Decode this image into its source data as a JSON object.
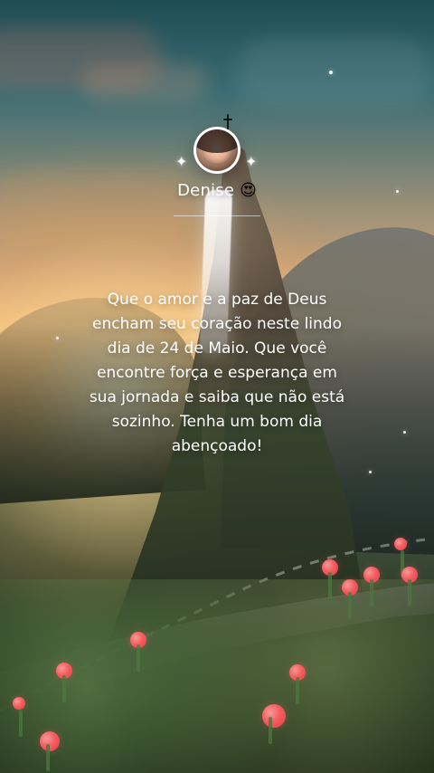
{
  "card": {
    "user": {
      "name": "Denise",
      "emoji": "😍"
    },
    "message": "Que o amor e a paz de Deus encham seu coração neste lindo dia de 24 de Maio. Que você encontre força e esperança em sua jornada e saiba que não está sozinho. Tenha um bom dia abençoado!",
    "icons": {
      "cross": "cross-icon",
      "sparkle": "sparkle-icon",
      "avatar": "avatar"
    }
  }
}
